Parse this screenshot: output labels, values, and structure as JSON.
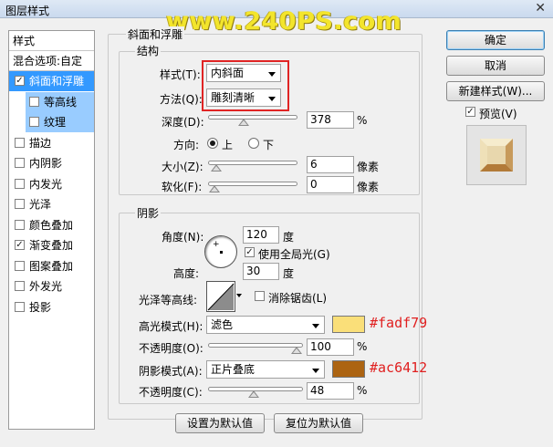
{
  "window": {
    "title": "图层样式",
    "close_glyph": "✕",
    "watermark": "www.240PS.com"
  },
  "left_panel": {
    "header": "样式",
    "blend_options": "混合选项:自定",
    "items": [
      {
        "label": "斜面和浮雕",
        "checked": true,
        "selected": true
      },
      {
        "label": "等高线",
        "checked": false,
        "sub": true
      },
      {
        "label": "纹理",
        "checked": false,
        "sub": true
      },
      {
        "label": "描边",
        "checked": false
      },
      {
        "label": "内阴影",
        "checked": false
      },
      {
        "label": "内发光",
        "checked": false
      },
      {
        "label": "光泽",
        "checked": false
      },
      {
        "label": "颜色叠加",
        "checked": false
      },
      {
        "label": "渐变叠加",
        "checked": true
      },
      {
        "label": "图案叠加",
        "checked": false
      },
      {
        "label": "外发光",
        "checked": false
      },
      {
        "label": "投影",
        "checked": false
      }
    ]
  },
  "bevel": {
    "group_title": "斜面和浮雕",
    "structure_title": "结构",
    "style_label": "样式(T):",
    "style_value": "内斜面",
    "technique_label": "方法(Q):",
    "technique_value": "雕刻清晰",
    "depth_label": "深度(D):",
    "depth_value": "378",
    "depth_unit": "%",
    "depth_fraction": 0.378,
    "direction_label": "方向:",
    "direction_up": "上",
    "direction_down": "下",
    "size_label": "大小(Z):",
    "size_value": "6",
    "size_unit": "像素",
    "size_fraction": 0.024,
    "soften_label": "软化(F):",
    "soften_value": "0",
    "soften_unit": "像素",
    "soften_fraction": 0.0
  },
  "shading": {
    "group_title": "阴影",
    "angle_label": "角度(N):",
    "angle_value": "120",
    "angle_unit": "度",
    "global_light_label": "使用全局光(G)",
    "global_light_checked": true,
    "altitude_label": "高度:",
    "altitude_value": "30",
    "altitude_unit": "度",
    "gloss_label": "光泽等高线:",
    "antialias_label": "消除锯齿(L)",
    "antialias_checked": false,
    "highlight_mode_label": "高光模式(H):",
    "highlight_mode_value": "滤色",
    "highlight_color": "#fadf79",
    "highlight_hex_text": "#fadf79",
    "highlight_opacity_label": "不透明度(O):",
    "highlight_opacity_value": "100",
    "highlight_opacity_unit": "%",
    "highlight_opacity_fraction": 1.0,
    "shadow_mode_label": "阴影模式(A):",
    "shadow_mode_value": "正片叠底",
    "shadow_color": "#ac6412",
    "shadow_hex_text": "#ac6412",
    "shadow_opacity_label": "不透明度(C):",
    "shadow_opacity_value": "48",
    "shadow_opacity_unit": "%",
    "shadow_opacity_fraction": 0.48
  },
  "bottom_buttons": {
    "set_default": "设置为默认值",
    "reset_default": "复位为默认值"
  },
  "right_panel": {
    "ok": "确定",
    "cancel": "取消",
    "new_style": "新建样式(W)...",
    "preview_label": "预览(V)",
    "preview_checked": true
  }
}
